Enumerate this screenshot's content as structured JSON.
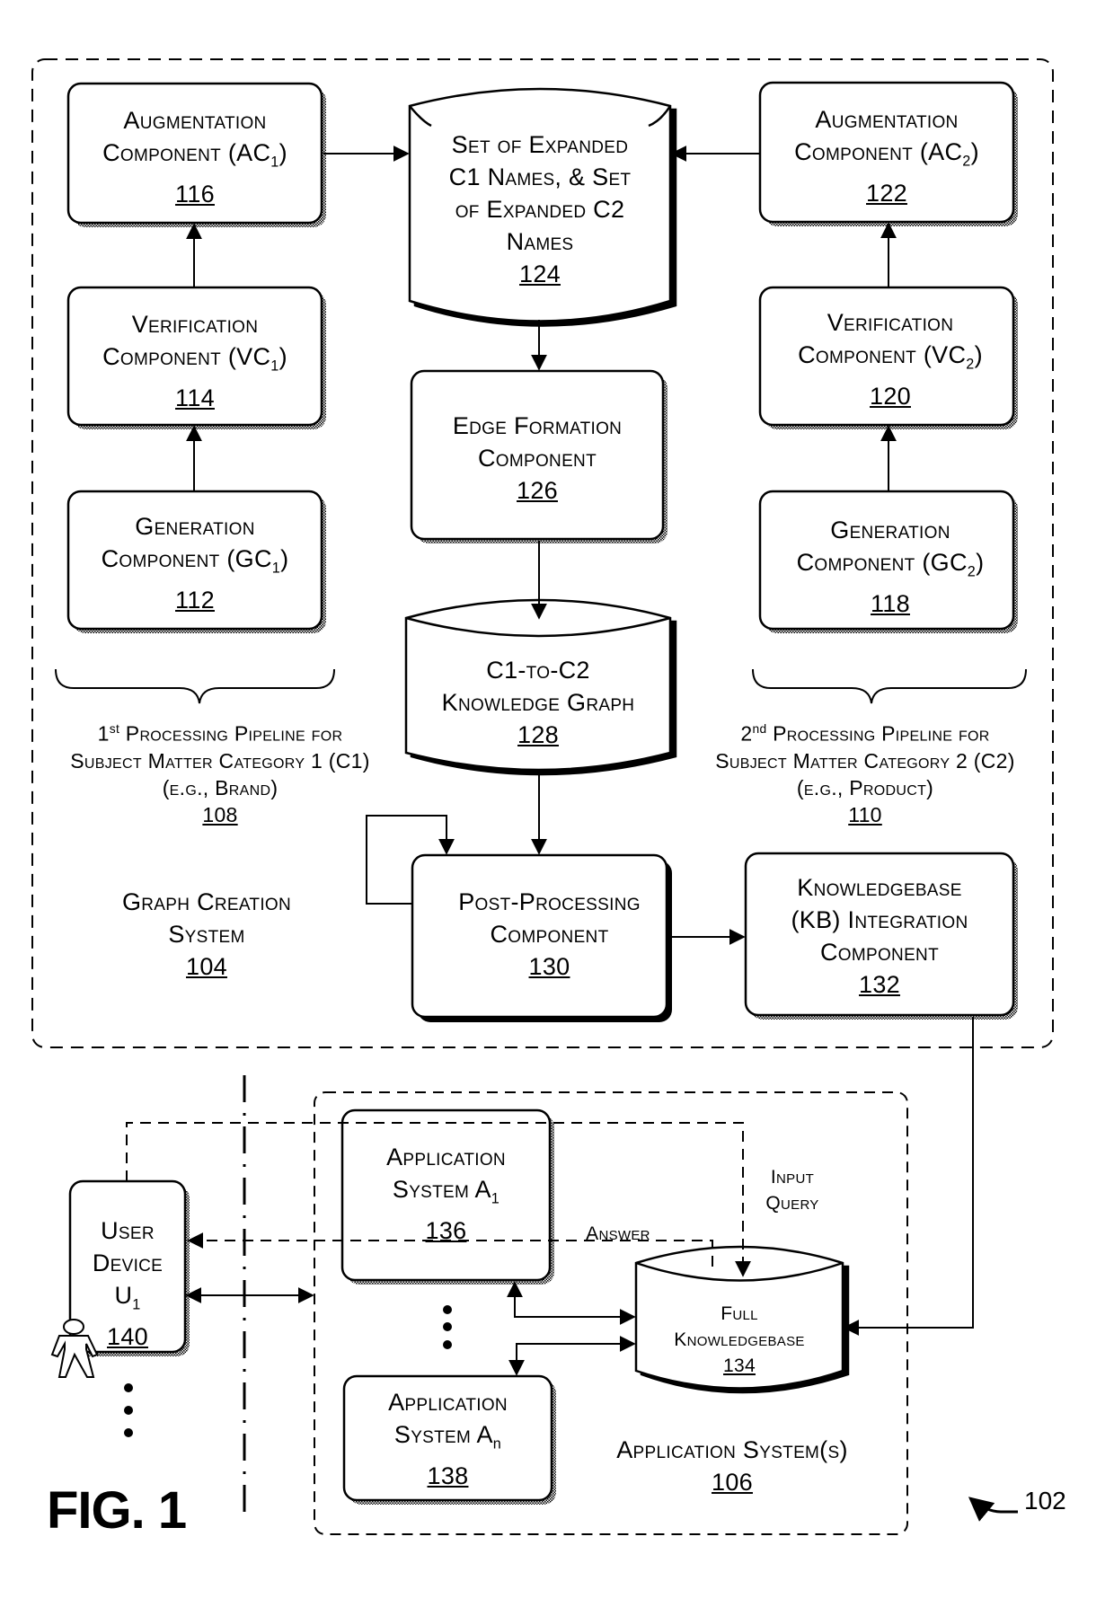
{
  "figure": {
    "title": "FIG. 1",
    "system_ref": "102"
  },
  "graph_creation_system": {
    "line1": "Graph Creation",
    "line2": "System",
    "ref": "104"
  },
  "pipeline1": {
    "line1_pre": "1",
    "line1_sup": "st",
    "line1_post": " Processing Pipeline for",
    "line2": "Subject Matter Category 1 (C1)",
    "line3": "(e.g., Brand)",
    "ref": "108"
  },
  "pipeline2": {
    "line1_pre": "2",
    "line1_sup": "nd",
    "line1_post": " Processing Pipeline for",
    "line2": "Subject Matter Category 2 (C2)",
    "line3": "(e.g., Product)",
    "ref": "110"
  },
  "components": {
    "ac1": {
      "line1": "Augmentation",
      "line2": "Component (AC",
      "sub": "1",
      "close": ")",
      "ref": "116"
    },
    "vc1": {
      "line1": "Verification",
      "line2": "Component (VC",
      "sub": "1",
      "close": ")",
      "ref": "114"
    },
    "gc1": {
      "line1": "Generation",
      "line2": "Component (GC",
      "sub": "1",
      "close": ")",
      "ref": "112"
    },
    "ac2": {
      "line1": "Augmentation",
      "line2": "Component (AC",
      "sub": "2",
      "close": ")",
      "ref": "122"
    },
    "vc2": {
      "line1": "Verification",
      "line2": "Component (VC",
      "sub": "2",
      "close": ")",
      "ref": "120"
    },
    "gc2": {
      "line1": "Generation",
      "line2": "Component (GC",
      "sub": "2",
      "close": ")",
      "ref": "118"
    },
    "expanded_names": {
      "line1": "Set of Expanded",
      "line2": "C1 Names, & Set",
      "line3": "of Expanded C2",
      "line4": "Names",
      "ref": "124"
    },
    "edge_formation": {
      "line1": "Edge Formation",
      "line2": "Component",
      "ref": "126"
    },
    "knowledge_graph": {
      "line1": "C1-to-C2",
      "line2": "Knowledge Graph",
      "ref": "128"
    },
    "post_processing": {
      "line1": "Post-Processing",
      "line2": "Component",
      "ref": "130"
    },
    "kb_integration": {
      "line1": "Knowledgebase",
      "line2": "(KB) Integration",
      "line3": "Component",
      "ref": "132"
    }
  },
  "application_systems": {
    "label": "Application System(s)",
    "ref": "106",
    "a1": {
      "line1": "Application",
      "line2": "System A",
      "sub": "1",
      "ref": "136"
    },
    "an": {
      "line1": "Application",
      "line2": "System A",
      "sub": "n",
      "ref": "138"
    },
    "full_kb": {
      "line1": "Full",
      "line2": "Knowledgebase",
      "ref": "134"
    },
    "input_query": {
      "line1": "Input",
      "line2": "Query"
    },
    "answer": "Answer"
  },
  "user_device": {
    "line1": "User",
    "line2": "Device",
    "line3": "U",
    "sub": "1",
    "ref": "140"
  }
}
